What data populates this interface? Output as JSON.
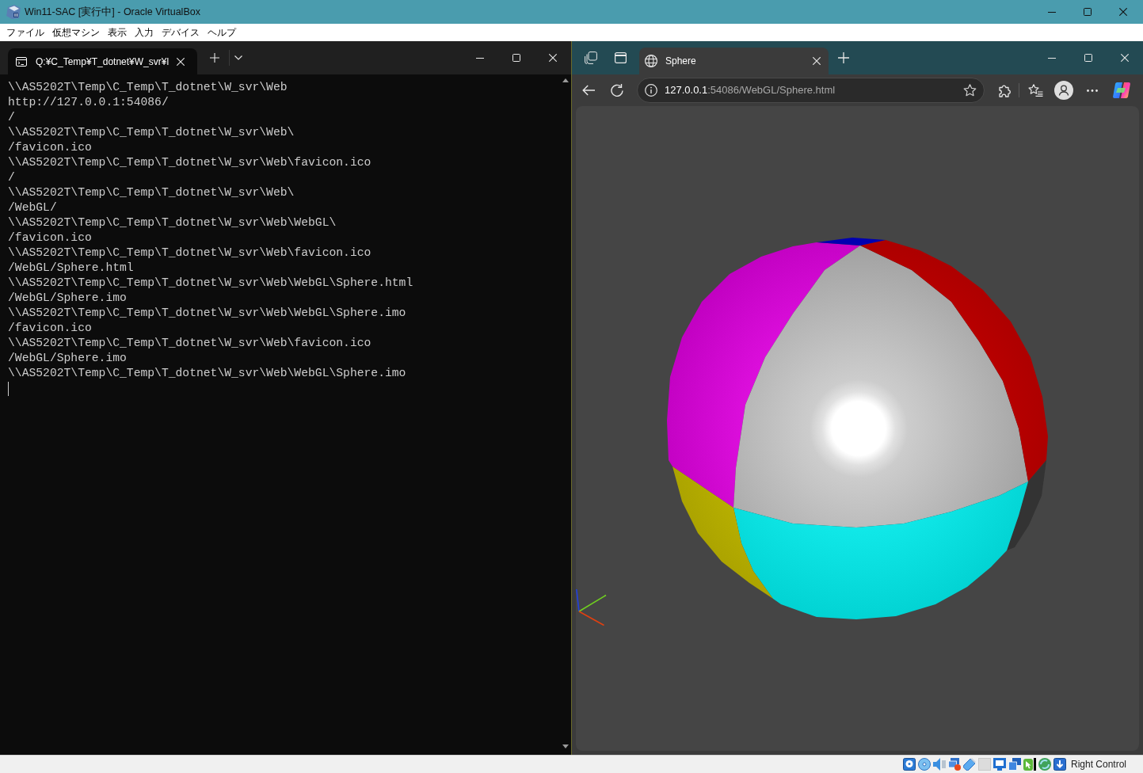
{
  "window": {
    "title": "Win11-SAC [実行中] - Oracle VirtualBox"
  },
  "menu": [
    "ファイル",
    "仮想マシン",
    "表示",
    "入力",
    "デバイス",
    "ヘルプ"
  ],
  "terminal": {
    "tabs": [
      {
        "title": "Q:¥C_Temp¥T_dotnet¥W_svr¥l",
        "selected": true
      }
    ],
    "lines": [
      "\\\\AS5202T\\Temp\\C_Temp\\T_dotnet\\W_svr\\Web",
      "http://127.0.0.1:54086/",
      "/",
      "\\\\AS5202T\\Temp\\C_Temp\\T_dotnet\\W_svr\\Web\\",
      "/favicon.ico",
      "\\\\AS5202T\\Temp\\C_Temp\\T_dotnet\\W_svr\\Web\\favicon.ico",
      "/",
      "\\\\AS5202T\\Temp\\C_Temp\\T_dotnet\\W_svr\\Web\\",
      "/WebGL/",
      "\\\\AS5202T\\Temp\\C_Temp\\T_dotnet\\W_svr\\Web\\WebGL\\",
      "/favicon.ico",
      "\\\\AS5202T\\Temp\\C_Temp\\T_dotnet\\W_svr\\Web\\favicon.ico",
      "/WebGL/Sphere.html",
      "\\\\AS5202T\\Temp\\C_Temp\\T_dotnet\\W_svr\\Web\\WebGL\\Sphere.html",
      "/WebGL/Sphere.imo",
      "\\\\AS5202T\\Temp\\C_Temp\\T_dotnet\\W_svr\\Web\\WebGL\\Sphere.imo",
      "/favicon.ico",
      "\\\\AS5202T\\Temp\\C_Temp\\T_dotnet\\W_svr\\Web\\favicon.ico",
      "/WebGL/Sphere.imo",
      "\\\\AS5202T\\Temp\\C_Temp\\T_dotnet\\W_svr\\Web\\WebGL\\Sphere.imo"
    ]
  },
  "browser": {
    "tabs": [
      {
        "title": "Sphere",
        "selected": true
      }
    ],
    "address": {
      "host": "127.0.0.1",
      "path": ":54086/WebGL/Sphere.html"
    }
  },
  "status_bar": {
    "host_key": "Right Control"
  }
}
